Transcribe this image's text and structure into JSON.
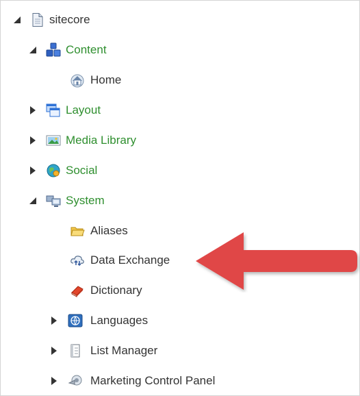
{
  "tree": {
    "root": {
      "label": "sitecore",
      "icon": "document-icon"
    },
    "content": {
      "label": "Content",
      "icon": "content-cubes-icon"
    },
    "home": {
      "label": "Home",
      "icon": "home-icon"
    },
    "layout": {
      "label": "Layout",
      "icon": "layout-windows-icon"
    },
    "media_library": {
      "label": "Media Library",
      "icon": "picture-icon"
    },
    "social": {
      "label": "Social",
      "icon": "social-globe-icon"
    },
    "system": {
      "label": "System",
      "icon": "system-computers-icon"
    },
    "aliases": {
      "label": "Aliases",
      "icon": "folder-icon"
    },
    "data_exchange": {
      "label": "Data Exchange",
      "icon": "cloud-exchange-icon"
    },
    "dictionary": {
      "label": "Dictionary",
      "icon": "book-icon"
    },
    "languages": {
      "label": "Languages",
      "icon": "language-globe-icon"
    },
    "list_manager": {
      "label": "List Manager",
      "icon": "list-icon"
    },
    "marketing_control_panel": {
      "label": "Marketing Control Panel",
      "icon": "marketing-panel-icon"
    }
  },
  "colors": {
    "section_label": "#2f8f2f",
    "default_label": "#333333",
    "callout_arrow": "#e04646"
  }
}
